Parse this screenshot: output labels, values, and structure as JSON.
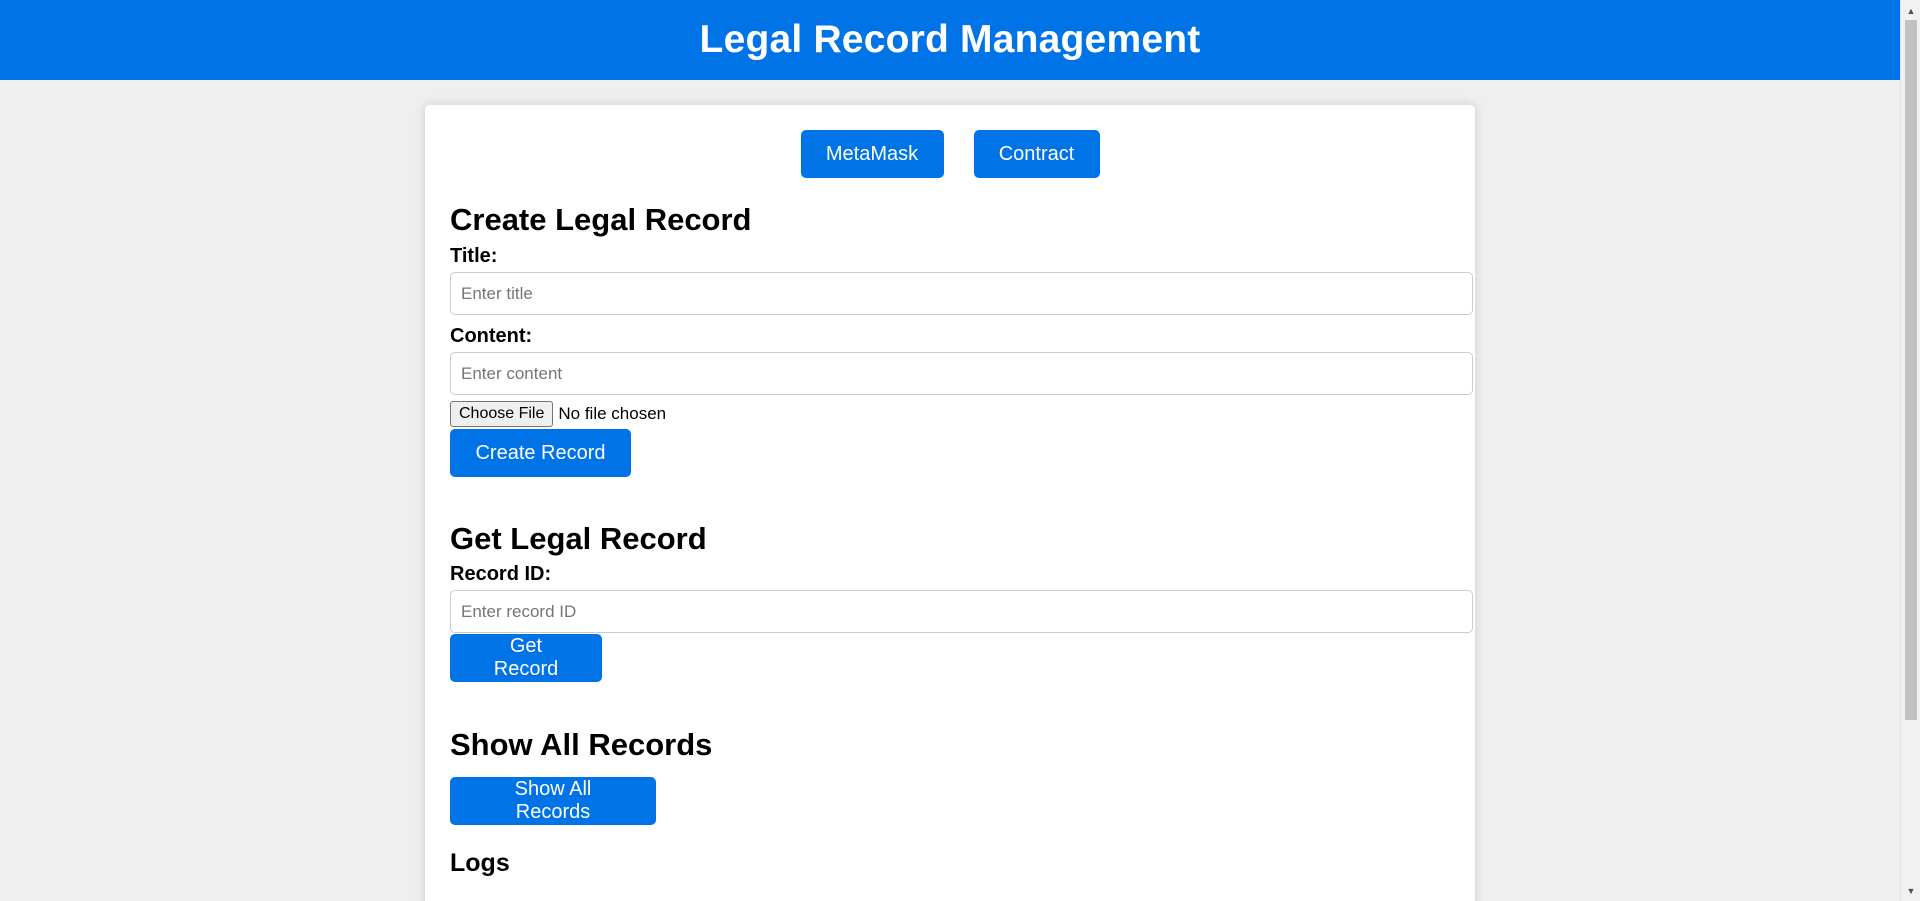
{
  "header": {
    "title": "Legal Record Management"
  },
  "top_buttons": {
    "metamask": "MetaMask",
    "contract": "Contract"
  },
  "create": {
    "heading": "Create Legal Record",
    "title_label": "Title:",
    "title_placeholder": "Enter title",
    "content_label": "Content:",
    "content_placeholder": "Enter content",
    "file_button": "Choose File",
    "file_status": "No file chosen",
    "submit": "Create Record"
  },
  "get": {
    "heading": "Get Legal Record",
    "id_label": "Record ID:",
    "id_placeholder": "Enter record ID",
    "submit": "Get Record"
  },
  "all": {
    "heading": "Show All Records",
    "button": "Show All Records"
  },
  "logs": {
    "heading": "Logs"
  },
  "colors": {
    "primary": "#0073e6",
    "background": "#efefef",
    "card": "#ffffff"
  },
  "icons": {
    "scroll_up": "triangle-up-icon",
    "scroll_down": "triangle-down-icon"
  }
}
